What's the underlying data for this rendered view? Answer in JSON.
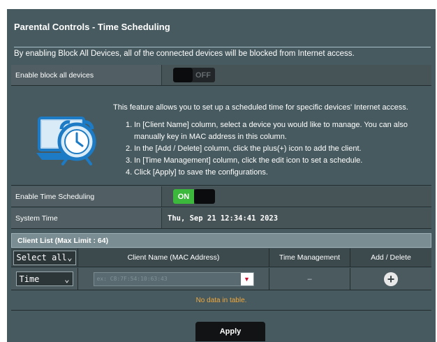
{
  "title": "Parental Controls - Time Scheduling",
  "description": "By enabling Block All Devices, all of the connected devices will be blocked from Internet access.",
  "block_all": {
    "label": "Enable block all devices",
    "state": "OFF"
  },
  "info": {
    "head": "This feature allows you to set up a scheduled time for specific devices' Internet access.",
    "steps": [
      {
        "num": "1.",
        "text": "In [Client Name] column, select a device you would like to manage. You can also manually key in MAC address in this column."
      },
      {
        "num": "2.",
        "text": "In the [Add / Delete] column, click the plus(+) icon to add the client."
      },
      {
        "num": "3.",
        "text": "In [Time Management] column, click the edit icon to set a schedule."
      },
      {
        "num": "4.",
        "text": "Click [Apply] to save the configurations."
      }
    ],
    "icon": "alarm-clock-laptop-icon"
  },
  "time_scheduling": {
    "label": "Enable Time Scheduling",
    "state": "ON"
  },
  "system_time": {
    "label": "System Time",
    "value": "Thu, Sep 21 12:34:41 2023"
  },
  "client_list": {
    "title": "Client List (Max Limit : 64)",
    "select_all": "Select all",
    "columns": [
      "Client Name (MAC Address)",
      "Time Management",
      "Add / Delete"
    ],
    "row": {
      "type": "Time",
      "mac_placeholder": "ex: C8:7F:54:10:63:43",
      "time_mgmt": "–"
    },
    "empty": "No data in table."
  },
  "apply_label": "Apply",
  "colors": {
    "on": "#3cb83c",
    "nodata": "#f0a83c",
    "background": "#475a5f"
  }
}
